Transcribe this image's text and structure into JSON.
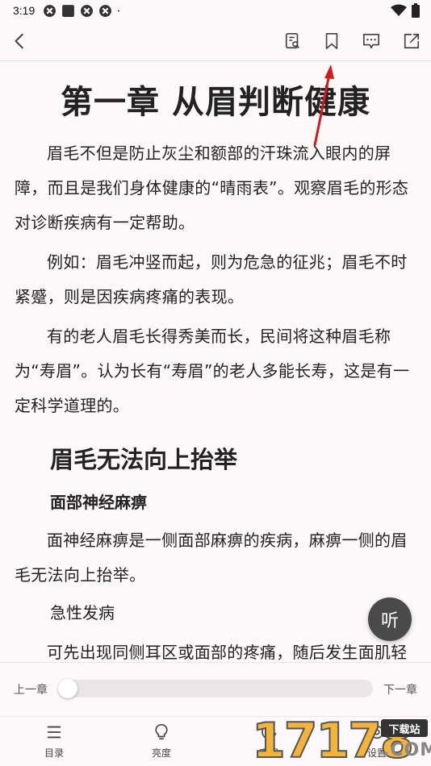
{
  "status_bar": {
    "time": "3:19",
    "icons": [
      "app-icon",
      "square-icon",
      "app-icon",
      "app-icon",
      "dot-icon"
    ],
    "right_icons": [
      "wifi-icon",
      "battery-icon"
    ]
  },
  "top_bar": {
    "icons": [
      "back-icon",
      "search-in-book-icon",
      "bookmark-icon",
      "comment-icon",
      "share-icon"
    ]
  },
  "content": {
    "chapter_title": "第一章 从眉判断健康",
    "paragraphs_1": [
      "眉毛不但是防止灰尘和额部的汗珠流入眼内的屏障，而且是我们身体健康的“晴雨表”。观察眉毛的形态对诊断疾病有一定帮助。",
      "例如：眉毛冲竖而起，则为危急的征兆；眉毛不时紧蹙，则是因疾病疼痛的表现。",
      "有的老人眉毛长得秀美而长，民间将这种眉毛称为“寿眉”。认为长有“寿眉”的老人多能长寿，这是有一定科学道理的。"
    ],
    "section_title": "眉毛无法向上抬举",
    "sub_title": "面部神经麻痹",
    "paragraph_2": "面神经麻痹是一侧面部麻痹的疾病，麻痹一侧的眉毛无法向上抬举。",
    "plain_line": "急性发病",
    "paragraph_3": "可先出现同侧耳区或面部的疼痛，随后发生面肌轻瘫，后者可进一步进展成为完全性面肌瘫痪。"
  },
  "listen_button": {
    "label": "听"
  },
  "progress": {
    "prev_label": "上一章",
    "next_label": "下一章",
    "value": 0
  },
  "tabs": [
    {
      "label": "目录",
      "icon": "menu-icon"
    },
    {
      "label": "亮度",
      "icon": "bulb-icon"
    },
    {
      "label": "夜间",
      "icon": "moon-icon"
    },
    {
      "label": "设置",
      "icon": "settings-icon"
    }
  ],
  "watermark": {
    "digits": "17178",
    "badge": "下载站",
    "suffix": ".COM"
  },
  "colors": {
    "background": "#fdf8fa",
    "text": "#222222",
    "arrow": "#d11a1a",
    "watermark_orange": "#f4b33a"
  }
}
